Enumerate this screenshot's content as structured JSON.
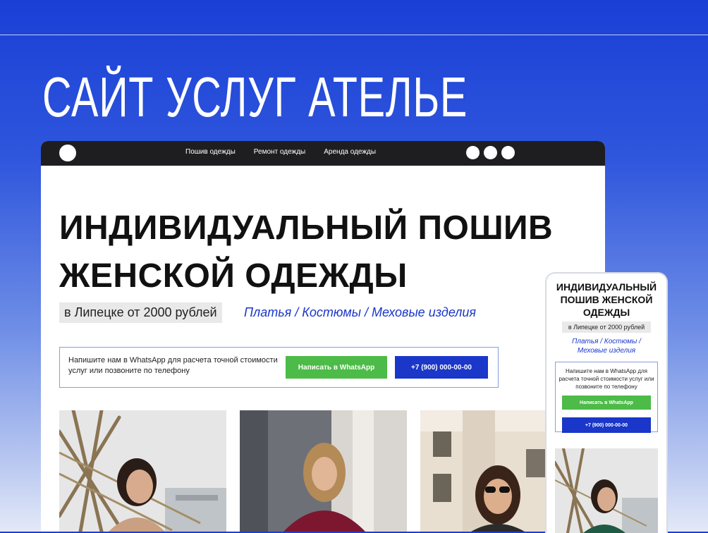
{
  "slide": {
    "heading": "САЙТ УСЛУГ АТЕЛЬЕ"
  },
  "desktop": {
    "nav": [
      "Пошив одежды",
      "Ремонт одежды",
      "Аренда одежды"
    ],
    "hero": {
      "title_line1": "ИНДИВИДУАЛЬНЫЙ ПОШИВ",
      "title_line2": "ЖЕНСКОЙ ОДЕЖДЫ",
      "price": "в Липецке от 2000 рублей",
      "categories": "Платья / Костюмы / Меховые изделия"
    },
    "contact": {
      "text": "Напишите нам в WhatsApp для расчета точной стоимости услуг или позвоните по телефону",
      "whatsapp_button": "Написать в WhatsApp",
      "phone_button": "+7 (900) 000-00-00"
    }
  },
  "mobile": {
    "title": "ИНДИВИДУАЛЬНЫЙ ПОШИВ ЖЕНСКОЙ ОДЕЖДЫ",
    "price": "в Липецке от 2000 рублей",
    "categories_line1": "Платья / Костюмы /",
    "categories_line2": "Меховые изделия",
    "contact_text": "Напишите нам в WhatsApp для расчета точной стоимости услуг или позвоните по телефону",
    "whatsapp_button": "Написать в WhatsApp",
    "phone_button": "+7 (900) 000-00-00"
  },
  "colors": {
    "accent_blue": "#1a37c9",
    "whatsapp_green": "#4cbb47",
    "browser_bar": "#1e1e20"
  }
}
